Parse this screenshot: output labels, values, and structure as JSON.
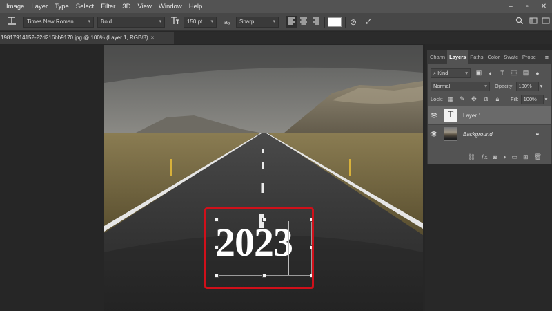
{
  "menu": [
    "Image",
    "Layer",
    "Type",
    "Select",
    "Filter",
    "3D",
    "View",
    "Window",
    "Help"
  ],
  "window_controls": {
    "minimize": "–",
    "restore": "▫",
    "close": "✕"
  },
  "options": {
    "font_family": "Times New Roman",
    "font_style": "Bold",
    "font_size": "150 pt",
    "aa_label": "aₐ",
    "antialias": "Sharp",
    "cancel_glyph": "⊘",
    "commit_glyph": "✓"
  },
  "document_tab": {
    "title": "19817914152-22d216bb9170.jpg @ 100% (Layer 1, RGB/8)",
    "close": "×"
  },
  "canvas": {
    "text_content": "2023"
  },
  "layers_panel": {
    "tabs": [
      "Chann",
      "Layers",
      "Paths",
      "Color",
      "Swatc",
      "Prope"
    ],
    "active_tab": "Layers",
    "menu_glyph": "≡",
    "filter_kind": "Kind",
    "blend_mode": "Normal",
    "opacity_label": "Opacity:",
    "opacity_value": "100%",
    "lock_label": "Lock:",
    "fill_label": "Fill:",
    "fill_value": "100%",
    "layers": [
      {
        "name": "Layer 1",
        "type": "text",
        "thumb_glyph": "T",
        "selected": true
      },
      {
        "name": "Background",
        "type": "image",
        "locked": true,
        "selected": false
      }
    ]
  },
  "colors": {
    "accent_selection": "#d0101a",
    "menubar_bg": "#535353",
    "panel_bg": "#535353"
  }
}
